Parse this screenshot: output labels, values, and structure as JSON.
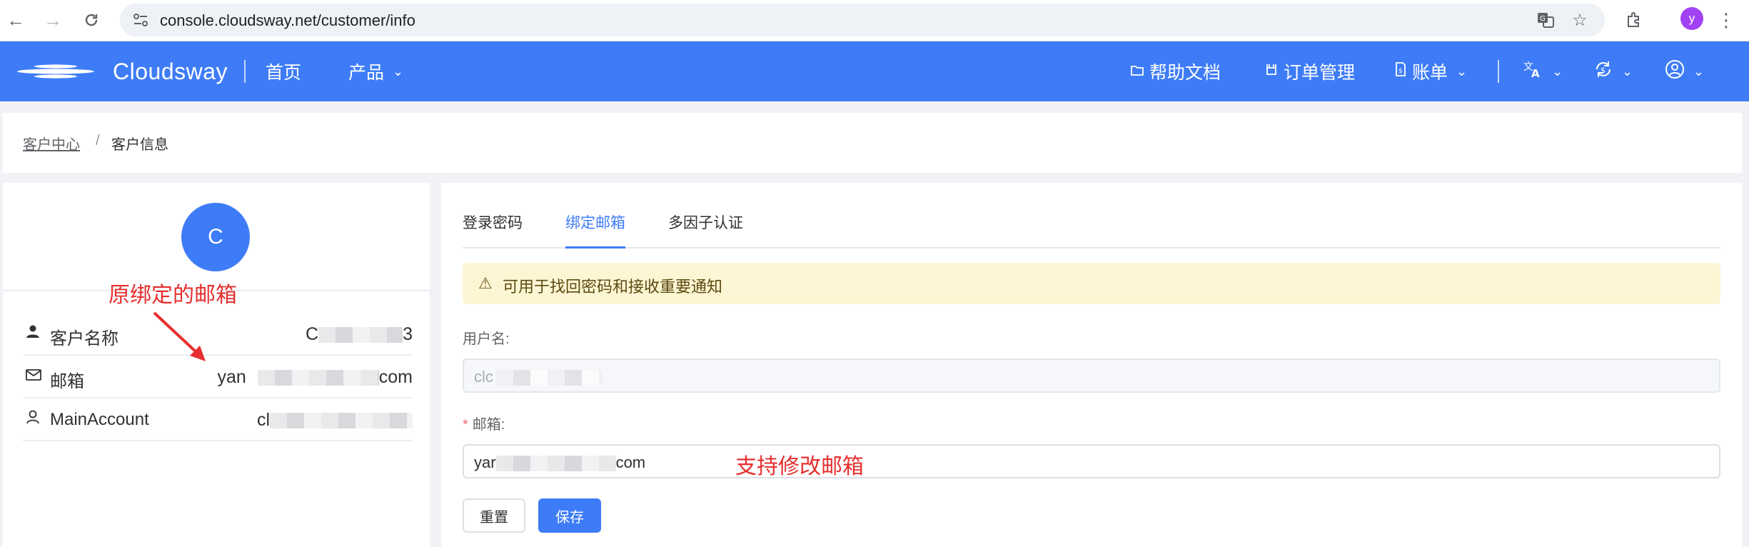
{
  "browser": {
    "url": "console.cloudsway.net/customer/info",
    "profile_initial": "y"
  },
  "topbar": {
    "brand": "Cloudsway",
    "home": "首页",
    "products": "产品",
    "help_docs": "帮助文档",
    "orders": "订单管理",
    "billing": "账单"
  },
  "breadcrumb": {
    "parent": "客户中心",
    "separator": "/",
    "current": "客户信息"
  },
  "profile": {
    "avatar_letter": "C",
    "rows": [
      {
        "label": "客户名称",
        "value_prefix": "C",
        "value_suffix": "3"
      },
      {
        "label": "邮箱",
        "value_prefix": "yan",
        "value_suffix": "com"
      },
      {
        "label": "MainAccount",
        "value_prefix": "cl",
        "value_suffix": ""
      }
    ]
  },
  "annotations": {
    "original_email": "原绑定的邮箱",
    "support_change": "支持修改邮箱"
  },
  "tabs": [
    "登录密码",
    "绑定邮箱",
    "多因子认证"
  ],
  "active_tab": 1,
  "alert": {
    "text": "可用于找回密码和接收重要通知"
  },
  "form": {
    "username_label": "用户名:",
    "username_value": "clc",
    "email_label": "邮箱:",
    "email_value_prefix": "yar",
    "email_value_suffix": "com",
    "reset_label": "重置",
    "save_label": "保存"
  },
  "colors": {
    "primary": "#3e7cf7",
    "annotation": "#e62f2f",
    "alert_bg": "#fdf6d4"
  }
}
